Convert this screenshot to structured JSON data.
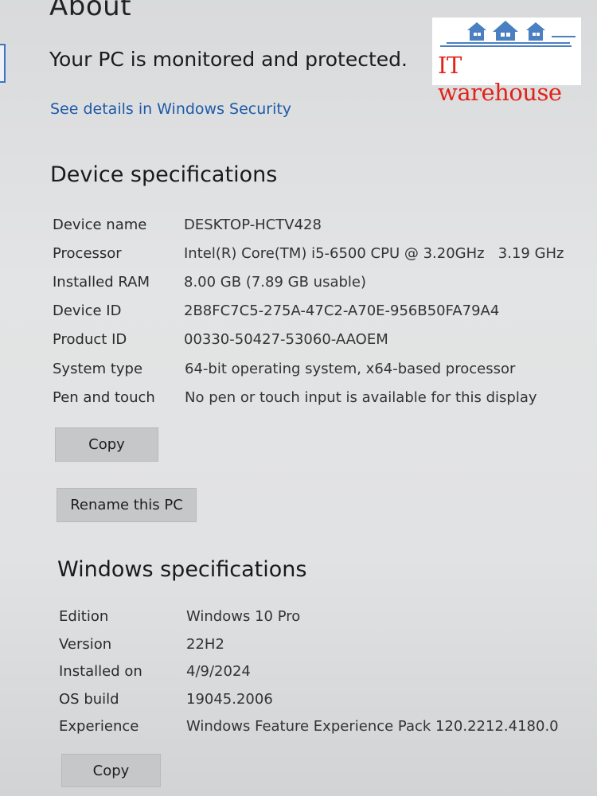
{
  "header": {
    "title": "About",
    "status": "Your PC is monitored and protected.",
    "security_link": "See details in Windows Security"
  },
  "device_specs": {
    "title": "Device specifications",
    "rows": [
      {
        "label": "Device name",
        "value": "DESKTOP-HCTV428"
      },
      {
        "label": "Processor",
        "value": "Intel(R) Core(TM) i5-6500 CPU @ 3.20GHz   3.19 GHz"
      },
      {
        "label": "Installed RAM",
        "value": "8.00 GB (7.89 GB usable)"
      },
      {
        "label": "Device ID",
        "value": "2B8FC7C5-275A-47C2-A70E-956B50FA79A4"
      },
      {
        "label": "Product ID",
        "value": "00330-50427-53060-AAOEM"
      },
      {
        "label": "System type",
        "value": "64-bit operating system, x64-based processor"
      },
      {
        "label": "Pen and touch",
        "value": "No pen or touch input is available for this display"
      }
    ],
    "copy_label": "Copy",
    "rename_label": "Rename this PC"
  },
  "windows_specs": {
    "title": "Windows specifications",
    "rows": [
      {
        "label": "Edition",
        "value": "Windows 10 Pro"
      },
      {
        "label": "Version",
        "value": "22H2"
      },
      {
        "label": "Installed on",
        "value": "4/9/2024"
      },
      {
        "label": "OS build",
        "value": "19045.2006"
      },
      {
        "label": "Experience",
        "value": "Windows Feature Experience Pack 120.2212.4180.0"
      }
    ],
    "copy_label": "Copy"
  },
  "watermark": {
    "text": "IT warehouse",
    "text_color": "#e2231a",
    "icon_color": "#4a7fc1"
  }
}
